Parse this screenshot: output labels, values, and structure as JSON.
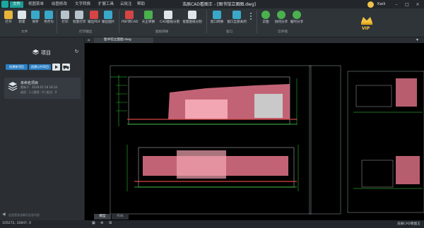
{
  "title_bar": {
    "menu_tabs": [
      "文件",
      "视图菜单",
      "绘图修改",
      "文字转换",
      "扩展工具",
      "云批注",
      "帮助"
    ],
    "window_title": "浩辰CAD看图王 - [图书馆立面图.dwg]",
    "user_name": "Kaili"
  },
  "ribbon": {
    "buttons": [
      "打开",
      "新建",
      "保存",
      "另存为",
      "打印",
      "批量打印",
      "输出PDF",
      "输出图片",
      "PDF转CAD",
      "天正转换",
      "CAD图纸分割",
      "批量图纸分割",
      "窗口转换",
      "窗口全部关闭",
      "云图",
      "协同分享",
      "临时分享"
    ],
    "groups": [
      "文件",
      "打印输出",
      "图纸转换",
      "窗口",
      "云存储"
    ],
    "vip_label": "VIP"
  },
  "left_panel": {
    "title": "项目",
    "new_project_label": "创建新项目",
    "join_project_label": "创建公共项目",
    "card": {
      "name": "未命名项目",
      "time": "更新于：2018-01-18 18:34",
      "meta": "成员：1 | 图纸：0 | 批注：0"
    },
    "chat_placeholder": "这里是发送聊天信息内容"
  },
  "doc_tab": "图书馆立面图.dwg",
  "layout_tabs": [
    "模型",
    "布局"
  ],
  "status_bar": {
    "coords": "105272, 32847, 0",
    "app_name": "浩辰CAD看图王"
  },
  "colors": {
    "accent": "#1c9c95",
    "drawing_pink": "#e4748a",
    "drawing_green": "#37e03a"
  }
}
